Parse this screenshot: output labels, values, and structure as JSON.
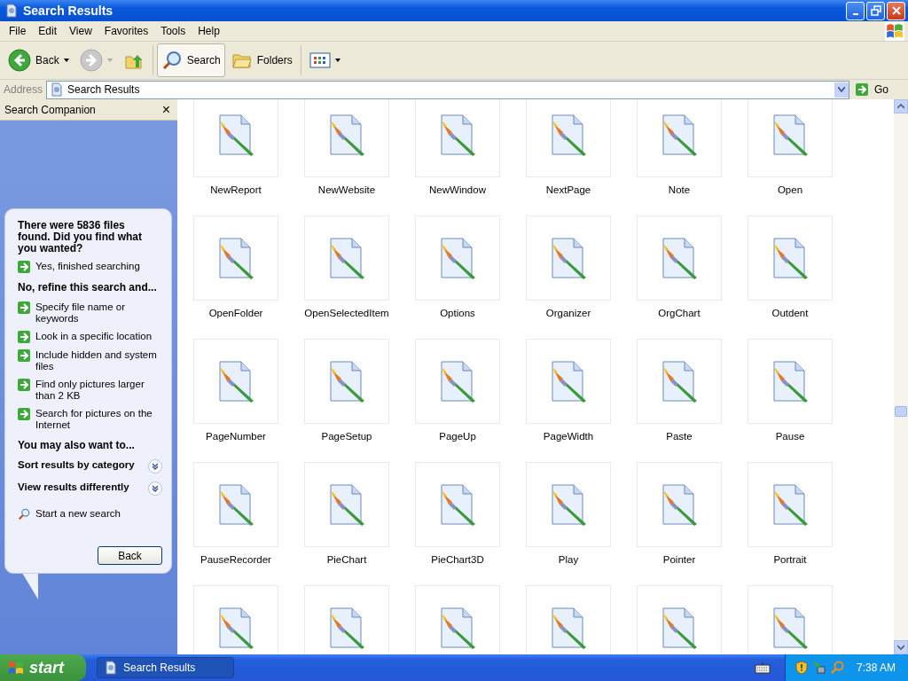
{
  "window": {
    "title": "Search Results"
  },
  "menu": [
    "File",
    "Edit",
    "View",
    "Favorites",
    "Tools",
    "Help"
  ],
  "toolbar": [
    {
      "kind": "back",
      "label": "Back",
      "disabled": false
    },
    {
      "kind": "forward",
      "disabled": true
    },
    {
      "kind": "up"
    },
    {
      "kind": "search",
      "label": "Search",
      "selected": true
    },
    {
      "kind": "folders",
      "label": "Folders",
      "selected": false
    },
    {
      "kind": "views"
    }
  ],
  "address": {
    "label": "Address",
    "value": "Search Results",
    "go": "Go"
  },
  "companion": {
    "title": "Search Companion",
    "close": "×",
    "question": "There were 5836 files found. Did you find what you wanted?",
    "options": [
      {
        "kind": "arrow",
        "label": "Yes, finished searching"
      },
      {
        "kind": "heading",
        "label": "No, refine this search and..."
      },
      {
        "kind": "arrow",
        "label": "Specify file name or keywords"
      },
      {
        "kind": "arrow",
        "label": "Look in a specific location"
      },
      {
        "kind": "arrow",
        "label": "Include hidden and system files"
      },
      {
        "kind": "arrow",
        "label": "Find only pictures larger than 2 KB"
      },
      {
        "kind": "arrow",
        "label": "Search for pictures on the Internet"
      },
      {
        "kind": "heading",
        "label": "You may also want to..."
      },
      {
        "kind": "expander",
        "label": "Sort results by category",
        "expanded": false
      },
      {
        "kind": "expander",
        "label": "View results differently",
        "expanded": false
      },
      {
        "kind": "search",
        "label": "Start a new search"
      }
    ],
    "button": "Back"
  },
  "files": [
    {
      "kind": "file",
      "name": "NewReport"
    },
    {
      "kind": "file",
      "name": "NewWebsite"
    },
    {
      "kind": "file",
      "name": "NewWindow"
    },
    {
      "kind": "file",
      "name": "NextPage"
    },
    {
      "kind": "file",
      "name": "Note"
    },
    {
      "kind": "file",
      "name": "Open"
    },
    {
      "kind": "file",
      "name": "OpenFolder"
    },
    {
      "kind": "file",
      "name": "OpenSelectedItem"
    },
    {
      "kind": "file",
      "name": "Options"
    },
    {
      "kind": "file",
      "name": "Organizer"
    },
    {
      "kind": "file",
      "name": "OrgChart"
    },
    {
      "kind": "file",
      "name": "Outdent"
    },
    {
      "kind": "file",
      "name": "PageNumber"
    },
    {
      "kind": "file",
      "name": "PageSetup"
    },
    {
      "kind": "file",
      "name": "PageUp"
    },
    {
      "kind": "file",
      "name": "PageWidth"
    },
    {
      "kind": "file",
      "name": "Paste"
    },
    {
      "kind": "file",
      "name": "Pause"
    },
    {
      "kind": "file",
      "name": "PauseRecorder"
    },
    {
      "kind": "file",
      "name": "PieChart"
    },
    {
      "kind": "file",
      "name": "PieChart3D"
    },
    {
      "kind": "file",
      "name": "Play"
    },
    {
      "kind": "file",
      "name": "Pointer"
    },
    {
      "kind": "file",
      "name": "Portrait"
    },
    {
      "kind": "file"
    },
    {
      "kind": "file"
    },
    {
      "kind": "file"
    },
    {
      "kind": "file"
    },
    {
      "kind": "file"
    },
    {
      "kind": "file"
    }
  ],
  "taskbar": {
    "start": "start",
    "tasks": [
      {
        "label": "Search Results",
        "selected": true
      }
    ],
    "clock": "7:38 AM"
  }
}
